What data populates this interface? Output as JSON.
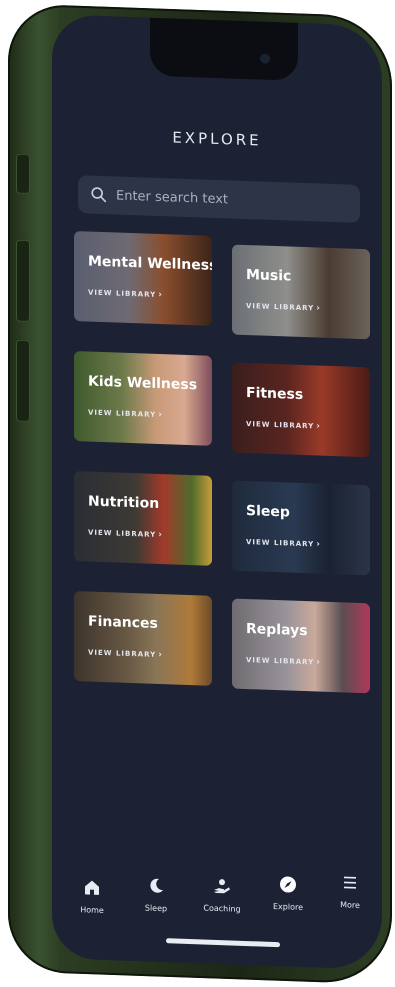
{
  "header": {
    "title": "EXPLORE"
  },
  "search": {
    "placeholder": "Enter search text"
  },
  "cards": [
    {
      "label": "Mental Wellness",
      "action": "VIEW LIBRARY"
    },
    {
      "label": "Music",
      "action": "VIEW LIBRARY"
    },
    {
      "label": "Kids Wellness",
      "action": "VIEW LIBRARY"
    },
    {
      "label": "Fitness",
      "action": "VIEW LIBRARY"
    },
    {
      "label": "Nutrition",
      "action": "VIEW LIBRARY"
    },
    {
      "label": "Sleep",
      "action": "VIEW LIBRARY"
    },
    {
      "label": "Finances",
      "action": "VIEW LIBRARY"
    },
    {
      "label": "Replays",
      "action": "VIEW LIBRARY"
    }
  ],
  "nav": {
    "items": [
      {
        "label": "Home",
        "icon": "home-icon"
      },
      {
        "label": "Sleep",
        "icon": "moon-icon"
      },
      {
        "label": "Coaching",
        "icon": "coaching-hand-icon"
      },
      {
        "label": "Explore",
        "icon": "compass-icon"
      },
      {
        "label": "More",
        "icon": "menu-icon"
      }
    ],
    "active": "Explore"
  },
  "colors": {
    "background": "#1c2234",
    "search_bg": "#2d3447",
    "phone_frame": "#2b3d22",
    "text": "#ffffff"
  }
}
